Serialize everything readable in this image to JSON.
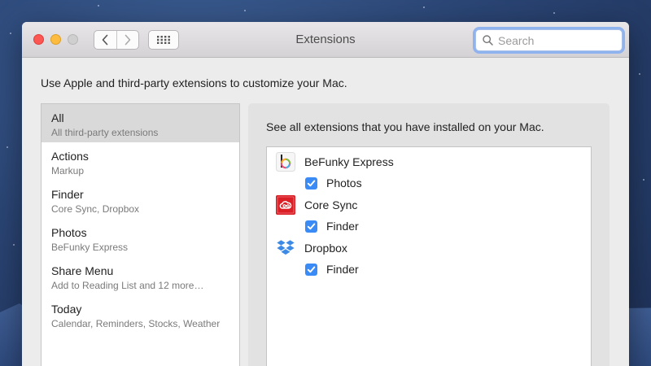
{
  "window": {
    "title": "Extensions"
  },
  "search": {
    "placeholder": "Search"
  },
  "intro_text": "Use Apple and third-party extensions to customize your Mac.",
  "sidebar": {
    "items": [
      {
        "label": "All",
        "sub": "All third-party extensions",
        "selected": true
      },
      {
        "label": "Actions",
        "sub": "Markup"
      },
      {
        "label": "Finder",
        "sub": "Core Sync, Dropbox"
      },
      {
        "label": "Photos",
        "sub": "BeFunky Express"
      },
      {
        "label": "Share Menu",
        "sub": "Add to Reading List and 12 more…"
      },
      {
        "label": "Today",
        "sub": "Calendar, Reminders, Stocks, Weather"
      }
    ]
  },
  "panel": {
    "description": "See all extensions that you have installed on your Mac.",
    "extensions": [
      {
        "name": "BeFunky Express",
        "icon": "befunky-icon",
        "target": "Photos",
        "checked": true
      },
      {
        "name": "Core Sync",
        "icon": "creative-cloud-icon",
        "target": "Finder",
        "checked": true
      },
      {
        "name": "Dropbox",
        "icon": "dropbox-icon",
        "target": "Finder",
        "checked": true
      }
    ]
  },
  "colors": {
    "accent": "#3b8bf7",
    "close": "#fc5753",
    "minimize": "#fdbc40",
    "zoom": "#cfcfcf"
  }
}
